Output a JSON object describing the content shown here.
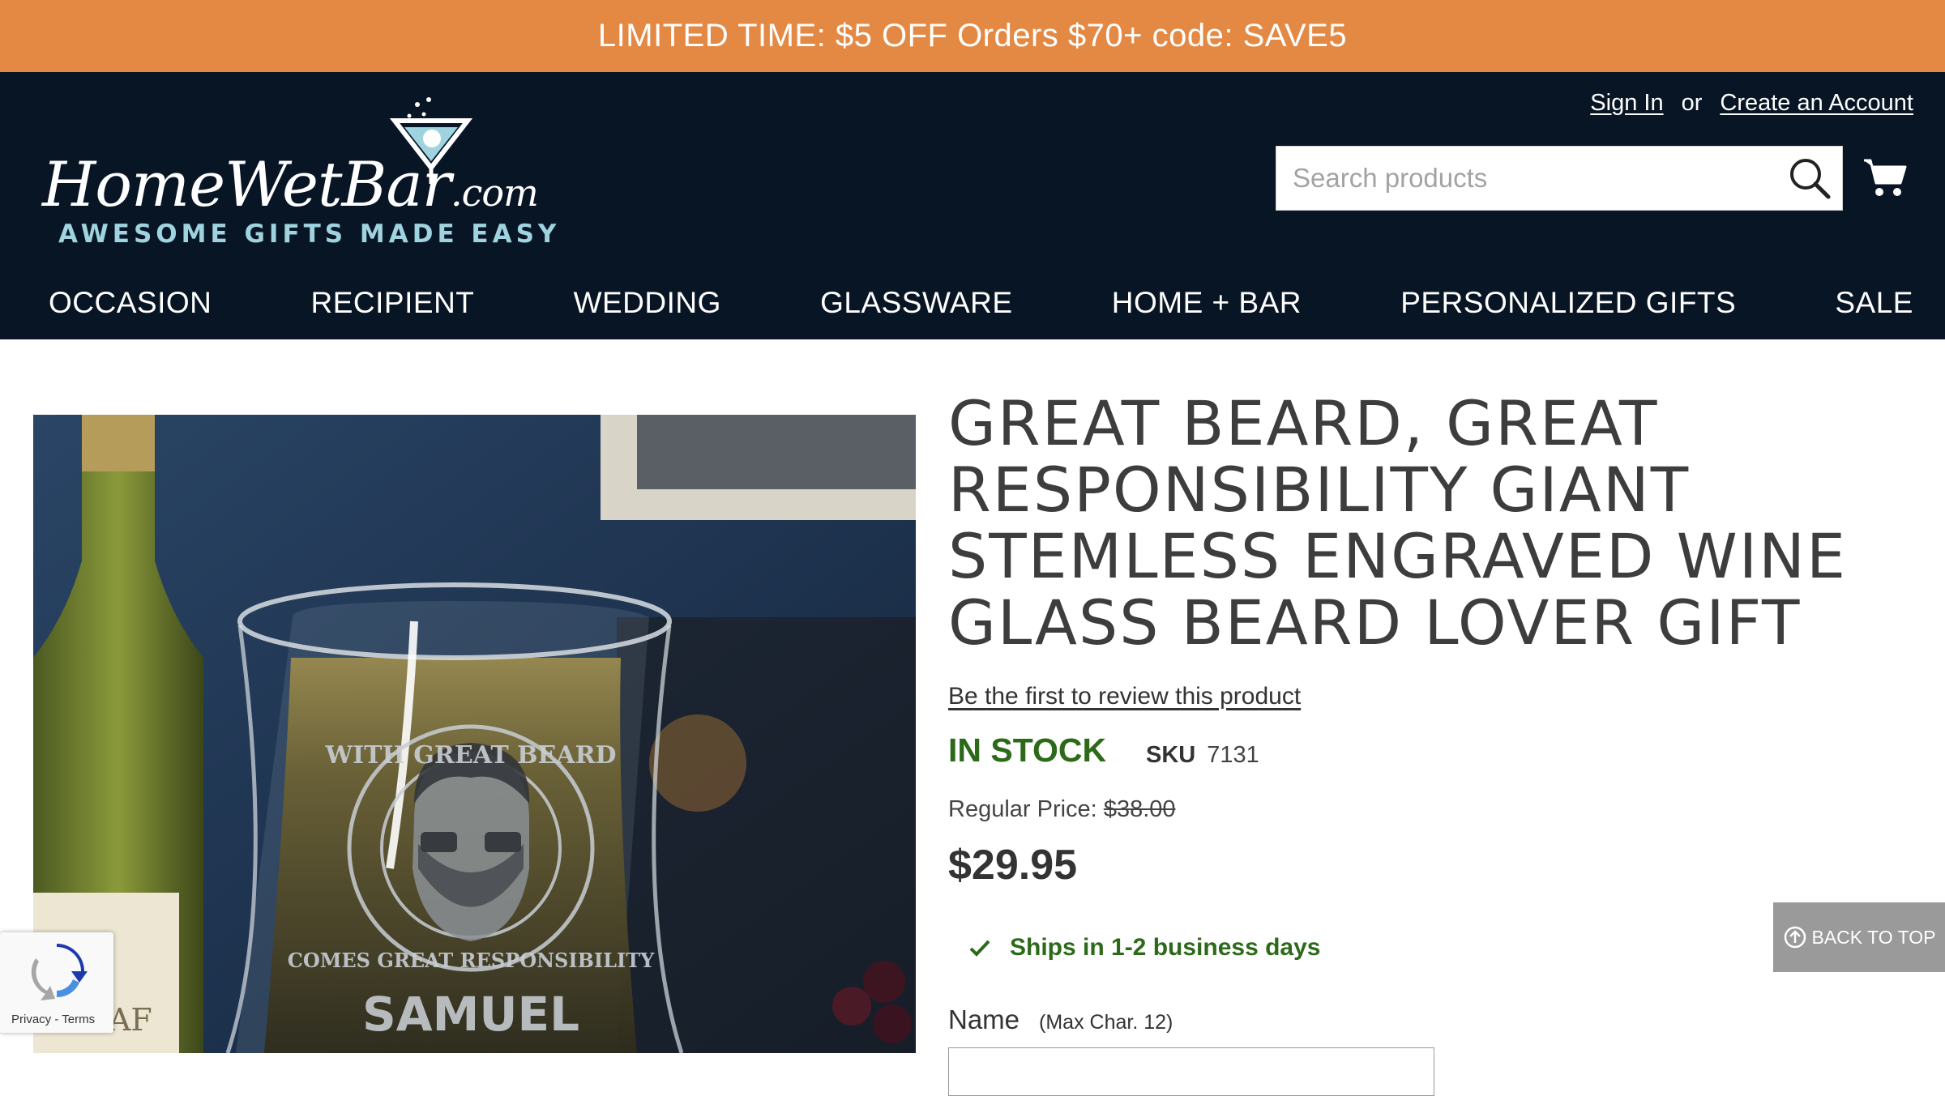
{
  "promo": {
    "text": "LIMITED TIME: $5 OFF Orders $70+ code: SAVE5"
  },
  "logo": {
    "script_text": "HomeWetBar",
    "dotcom": ".com",
    "tagline": "AWESOME GIFTS MADE EASY"
  },
  "account": {
    "sign_in": "Sign In",
    "or": "or",
    "create": "Create an Account"
  },
  "search": {
    "placeholder": "Search products",
    "value": ""
  },
  "nav": {
    "items": [
      "OCCASION",
      "RECIPIENT",
      "WEDDING",
      "GLASSWARE",
      "HOME + BAR",
      "PERSONALIZED GIFTS",
      "SALE"
    ]
  },
  "hero": {
    "engraving_top": "WITH GREAT BEARD",
    "engraving_bottom": "COMES GREAT RESPONSIBILITY",
    "engraving_name": "SAMUEL",
    "bottle_label": "LEAF"
  },
  "product": {
    "title": "GREAT BEARD, GREAT RESPONSIBILITY GIANT STEMLESS ENGRAVED WINE GLASS BEARD LOVER GIFT",
    "review_link": "Be the first to review this product",
    "stock": "IN STOCK",
    "sku_label": "SKU",
    "sku_value": "7131",
    "regular_label": "Regular Price:",
    "regular_price": "$38.00",
    "price": "$29.95",
    "shipping": "Ships in 1-2 business days",
    "name_label": "Name",
    "name_hint": "(Max Char. 12)"
  },
  "back_to_top": "BACK TO TOP",
  "recaptcha": {
    "links": "Privacy - Terms"
  },
  "colors": {
    "promo_bg": "#e48944",
    "header_bg": "#081524",
    "stock_green": "#2c6a1a",
    "tagline_blue": "#9fd3e0"
  }
}
